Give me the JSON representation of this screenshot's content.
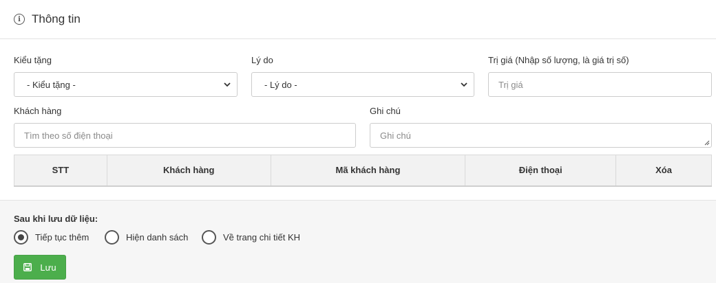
{
  "header": {
    "title": "Thông tin",
    "icon": "info-icon"
  },
  "form": {
    "gift_type": {
      "label": "Kiểu tặng",
      "value": "- Kiểu tặng -"
    },
    "reason": {
      "label": "Lý do",
      "value": "- Lý do -"
    },
    "value_field": {
      "label": "Trị giá (Nhập số lượng, là giá trị số)",
      "placeholder": "Trị giá"
    },
    "customer": {
      "label": "Khách hàng",
      "placeholder": "Tìm theo số điện thoại"
    },
    "note": {
      "label": "Ghi chú",
      "placeholder": "Ghi chú"
    }
  },
  "table": {
    "columns": [
      "STT",
      "Khách hàng",
      "Mã khách hàng",
      "Điện thoại",
      "Xóa"
    ],
    "rows": []
  },
  "footer": {
    "after_save_label": "Sau khi lưu dữ liệu:",
    "options": [
      {
        "label": "Tiếp tục thêm",
        "selected": true
      },
      {
        "label": "Hiện danh sách",
        "selected": false
      },
      {
        "label": "Về trang chi tiết KH",
        "selected": false
      }
    ],
    "save_label": "Lưu"
  },
  "colors": {
    "save_button": "#4cae4c",
    "header_bg": "#f2f2f2",
    "footer_bg": "#f6f6f6"
  }
}
